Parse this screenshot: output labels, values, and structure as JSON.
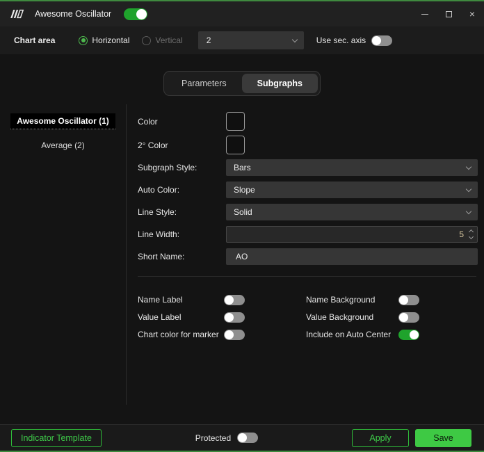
{
  "colors": {
    "accent_green": "#2fbf3a",
    "save_button_bg": "#3ec944",
    "toggle_on_green": "#1fa32c",
    "window_border_green": "#3f8a3f"
  },
  "icons": {
    "app_logo": "app-logo-icon",
    "minimize": "minimize-icon",
    "maximize": "maximize-icon",
    "close": "close-icon",
    "dropdown": "chevron-down-icon",
    "spinner": "spinner-up-down-icons"
  },
  "titlebar": {
    "title": "Awesome Oscillator",
    "indicator_enabled": true,
    "close_glyph": "×"
  },
  "header": {
    "chart_area_label": "Chart area",
    "radios": [
      {
        "label": "Horizontal",
        "checked": true,
        "disabled": false
      },
      {
        "label": "Vertical",
        "checked": false,
        "disabled": true
      }
    ],
    "area_count_value": "2",
    "sec_axis_label": "Use sec. axis",
    "sec_axis_on": false
  },
  "tabs": [
    {
      "label": "Parameters",
      "active": false
    },
    {
      "label": "Subgraphs",
      "active": true
    }
  ],
  "sidebar": [
    {
      "label": "Awesome Oscillator (1)",
      "selected": true
    },
    {
      "label": "Average (2)",
      "selected": false
    }
  ],
  "form": {
    "color_label": "Color",
    "color_value": "#29c21e",
    "secondary_color_label": "2° Color",
    "secondary_color_value": "#6a2d9e",
    "subgraph_style_label": "Subgraph Style:",
    "subgraph_style_value": "Bars",
    "auto_color_label": "Auto Color:",
    "auto_color_value": "Slope",
    "line_style_label": "Line Style:",
    "line_style_value": "Solid",
    "line_width_label": "Line Width:",
    "line_width_value": "5",
    "short_name_label": "Short Name:",
    "short_name_value": "AO"
  },
  "switches": {
    "left": [
      {
        "label": "Name Label",
        "on": false
      },
      {
        "label": "Value Label",
        "on": false
      },
      {
        "label": "Chart color for marker",
        "on": false
      }
    ],
    "right": [
      {
        "label": "Name Background",
        "on": false
      },
      {
        "label": "Value Background",
        "on": false
      },
      {
        "label": "Include on Auto Center",
        "on": true
      }
    ]
  },
  "footer": {
    "indicator_template_label": "Indicator Template",
    "protected_label": "Protected",
    "protected_on": false,
    "apply_label": "Apply",
    "save_label": "Save"
  }
}
